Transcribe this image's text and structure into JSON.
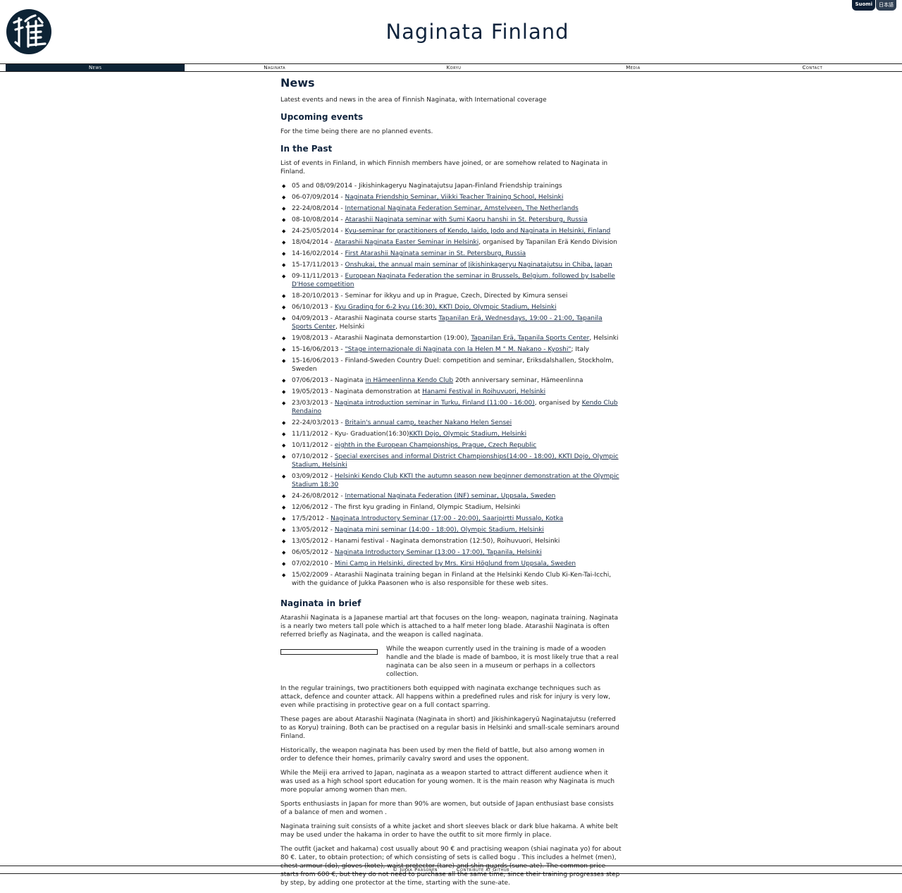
{
  "header": {
    "title": "Naginata Finland",
    "logo_icon": "naginata-kanji-logo-icon"
  },
  "languages": [
    {
      "label": "Suomi",
      "active": true
    },
    {
      "label": "日本語",
      "active": false
    }
  ],
  "nav": [
    {
      "label": "News",
      "active": true
    },
    {
      "label": "Naginata",
      "active": false
    },
    {
      "label": "Koryu",
      "active": false
    },
    {
      "label": "Media",
      "active": false
    },
    {
      "label": "Contact",
      "active": false
    }
  ],
  "main": {
    "title": "News",
    "intro": "Latest events and news in the area of Finnish Naginata, with International coverage",
    "upcoming": {
      "title": "Upcoming events",
      "text": "For the time being there are no planned events."
    },
    "past": {
      "title": "In the Past",
      "text": "List of events in Finland, in which Finnish members have joined, or are somehow related to Naginata in Finland.",
      "events": [
        [
          {
            "t": "05 and 08/09/2014 - Jikishinkageryu Naginatajutsu Japan-Finland Friendship trainings"
          }
        ],
        [
          {
            "t": "06-07/09/2014 - "
          },
          {
            "t": "Naginata Friendship Seminar, Viikki Teacher Training School, Helsinki",
            "link": true
          }
        ],
        [
          {
            "t": "22-24/08/2014 - "
          },
          {
            "t": "International Naginata Federation Seminar, Amstelveen, The Netherlands",
            "link": true
          }
        ],
        [
          {
            "t": "08-10/08/2014 - "
          },
          {
            "t": "Atarashii Naginata seminar with Sumi Kaoru hanshi in St. Petersburg, Russia",
            "link": true
          }
        ],
        [
          {
            "t": "24-25/05/2014 - "
          },
          {
            "t": "Kyu-seminar for practitioners of Kendo, Iaido, Jodo and Naginata in Helsinki, Finland",
            "link": true
          }
        ],
        [
          {
            "t": "18/04/2014 - "
          },
          {
            "t": "Atarashii Naginata Easter Seminar in Helsinki",
            "link": true
          },
          {
            "t": ", organised by Tapanilan Erä Kendo Division"
          }
        ],
        [
          {
            "t": "14-16/02/2014 - "
          },
          {
            "t": "First Atarashii Naginata seminar in St. Petersburg, Russia",
            "link": true
          }
        ],
        [
          {
            "t": "15-17/11/2013 - "
          },
          {
            "t": "Onshukai, the annual main seminar of Jikishinkageryu Naginatajutsu in Chiba, Japan",
            "link": true
          }
        ],
        [
          {
            "t": "09-11/11/2013 - "
          },
          {
            "t": "European Naginata Federation the seminar in Brussels, Belgium. followed by Isabelle D'Hose competition",
            "link": true
          }
        ],
        [
          {
            "t": "18-20/10/2013 - Seminar for ikkyu and up in Prague, Czech, Directed by Kimura sensei"
          }
        ],
        [
          {
            "t": "06/10/2013 - "
          },
          {
            "t": "Kyu Grading for 6-2 kyu (16:30), KKTI Dojo, Olympic Stadium, Helsinki",
            "link": true
          }
        ],
        [
          {
            "t": "04/09/2013 - Atarashii Naginata course starts "
          },
          {
            "t": "Tapanilan Erä, Wednesdays, 19:00 - 21:00, Tapanila Sports Center",
            "link": true
          },
          {
            "t": ", Helsinki"
          }
        ],
        [
          {
            "t": "19/08/2013 - Atarashii Naginata demonstartion (19:00), "
          },
          {
            "t": "Tapanilan Erä, Tapanila Sports Center",
            "link": true
          },
          {
            "t": ", Helsinki"
          }
        ],
        [
          {
            "t": "15-16/06/2013 - "
          },
          {
            "t": "\"Stage internazionale di Naginata con la Helen M ° M. Nakano - Kyoshi\"",
            "link": true
          },
          {
            "t": "; Italy"
          }
        ],
        [
          {
            "t": "15-16/06/2013 - Finland-Sweden Country Duel: competition and seminar, Eriksdalshallen, Stockholm, Sweden"
          }
        ],
        [
          {
            "t": "07/06/2013 - Naginata "
          },
          {
            "t": "in Hämeenlinna Kendo Club",
            "link": true
          },
          {
            "t": " 20th anniversary seminar, Hämeenlinna"
          }
        ],
        [
          {
            "t": "19/05/2013 - Naginata demonstration at "
          },
          {
            "t": "Hanami Festival in Roihuvuori, Helsinki",
            "link": true
          }
        ],
        [
          {
            "t": "23/03/2013 - "
          },
          {
            "t": "Naginata introduction seminar in Turku, Finland (11:00 - 16:00)",
            "link": true
          },
          {
            "t": ", organised by "
          },
          {
            "t": "Kendo Club Rendaino",
            "link": true
          }
        ],
        [
          {
            "t": "22-24/03/2013 - "
          },
          {
            "t": "Britain's annual camp, teacher Nakano Helen Sensei",
            "link": true
          }
        ],
        [
          {
            "t": "11/11/2012 - Kyu- Graduation(16:30)"
          },
          {
            "t": "KKTI Dojo, Olympic Stadium, Helsinki",
            "link": true
          }
        ],
        [
          {
            "t": "10/11/2012 - "
          },
          {
            "t": "eighth in the European Championships, Prague, Czech Republic",
            "link": true
          }
        ],
        [
          {
            "t": "07/10/2012 - "
          },
          {
            "t": "Special exercises and informal District Championships(14:00 - 18:00), KKTI Dojo, Olympic Stadium, Helsinki",
            "link": true
          }
        ],
        [
          {
            "t": "03/09/2012 - "
          },
          {
            "t": "Helsinki Kendo Club KKTI the autumn season new beginner demonstration at the Olympic Stadium 18:30",
            "link": true
          }
        ],
        [
          {
            "t": "24-26/08/2012 - "
          },
          {
            "t": "International Naginata Federation (INF) seminar, Uppsala, Sweden",
            "link": true
          }
        ],
        [
          {
            "t": "12/06/2012 - The first kyu grading in Finland, Olympic Stadium, Helsinki"
          }
        ],
        [
          {
            "t": "17/5/2012 - "
          },
          {
            "t": "Naginata Introductory Seminar (17:00 - 20:00), Saaripirtti Mussalo, Kotka",
            "link": true
          }
        ],
        [
          {
            "t": "13/05/2012 - "
          },
          {
            "t": "Naginata mini seminar (14:00 - 18:00), Olympic Stadium, Helsinki",
            "link": true
          }
        ],
        [
          {
            "t": "13/05/2012 - Hanami festival - Naginata demonstration (12:50), Roihuvuori, Helsinki"
          }
        ],
        [
          {
            "t": "06/05/2012 - "
          },
          {
            "t": "Naginata Introductory Seminar (13:00 - 17:00), Tapanila, Helsinki",
            "link": true
          }
        ],
        [
          {
            "t": "07/02/2010 - "
          },
          {
            "t": "Mini Camp in Helsinki, directed by Mrs. Kirsi Höglund from Uppsala, Sweden",
            "link": true
          }
        ],
        [
          {
            "t": "15/02/2009 - Atarashii Naginata training began in Finland at the Helsinki Kendo Club Ki-Ken-Tai-Icchi, with the guidance of Jukka Paasonen who is also responsible for these web sites."
          }
        ]
      ]
    },
    "brief": {
      "title": "Naginata in brief",
      "p1": "Atarashii Naginata is a Japanese martial art that focuses on the long- weapon, naginata training. Naginata is a nearly two meters tall pole which is attached to a half meter long blade. Atarashii Naginata is often referred briefly as Naginata, and the weapon is called naginata.",
      "figure_text": "While the weapon currently used in the training is made of a wooden handle and the blade is made of bamboo, it is most likely true that a real naginata can be also seen in a museum or perhaps in a collectors collection.",
      "paragraphs": [
        "In the regular trainings, two practitioners both equipped with naginata exchange techniques such as attack, defence and counter attack. All happens within a predefined rules and risk for injury is very low, even while practising in protective gear on a full contact sparring.",
        "These pages are about Atarashii Naginata (Naginata in short) and Jikishinkageryū Naginatajutsu (referred to as Koryu) training. Both can be practised on a regular basis in Helsinki and small-scale seminars around Finland.",
        "Historically, the weapon naginata has been used by men the field of battle, but also among women in order to defence their homes, primarily cavalry sword and uses the opponent.",
        "While the Meiji era arrived to Japan, naginata as a weapon started to attract different audience when it was used as a high school sport education for young women. It is the main reason why Naginata is much more popular among women than men.",
        "Sports enthusiasts in Japan for more than 90% are women, but outside of Japan enthusiast base consists of a balance of men and women .",
        "Naginata training suit consists of a white jacket and short sleeves black or dark blue hakama. A white belt may be used under the hakama in order to have the outfit to sit more firmly in place.",
        "The outfit (jacket and hakama) cost usually about 90 € and practising weapon (shiai naginata yo) for about 80 €. Later, to obtain protection; of which consisting of sets is called bogu . This includes a helmet (men), chest armour (do), gloves (kote), waist protector (tare) and shin guards (sune-ate). The common price starts from 600 €, but they do not need to purchase all the same time, since their training progresses step by step, by adding one protector at the time, starting with the sune-ate."
      ]
    }
  },
  "footer": {
    "copyright": "© Jukka Paasonen",
    "github": "Contribute at Github"
  },
  "colors": {
    "brand": "#0d2335",
    "link": "#1b2f4a"
  }
}
